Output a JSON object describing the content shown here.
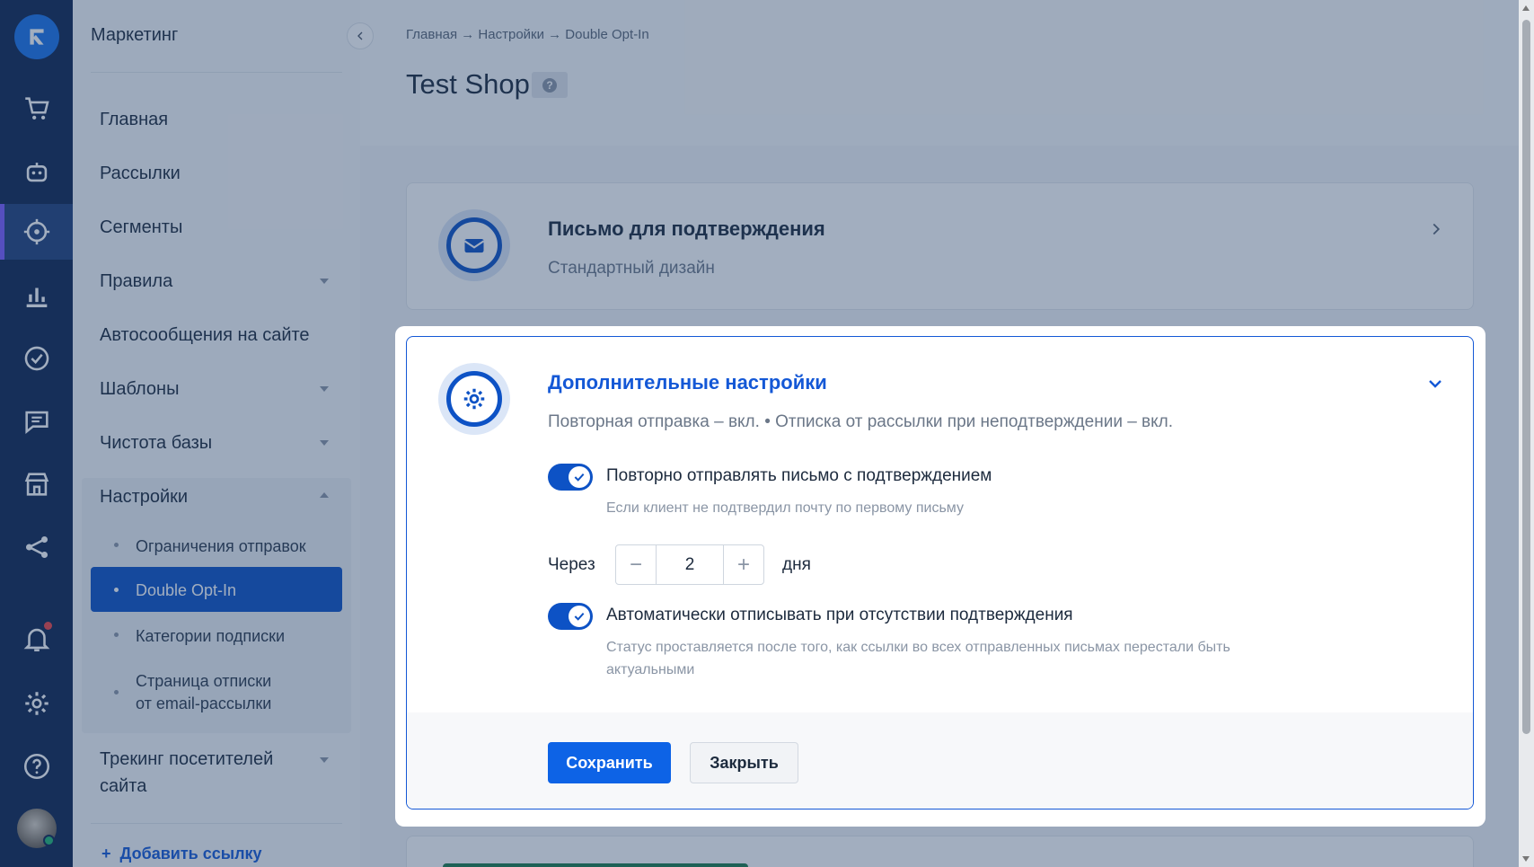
{
  "sidebar": {
    "title": "Маркетинг",
    "items": [
      {
        "label": "Главная"
      },
      {
        "label": "Рассылки"
      },
      {
        "label": "Сегменты"
      },
      {
        "label": "Правила"
      },
      {
        "label": "Автосообщения на сайте"
      },
      {
        "label": "Шаблоны"
      },
      {
        "label": "Чистота базы"
      },
      {
        "label": "Настройки"
      },
      {
        "label": "Трекинг посетителей сайта"
      }
    ],
    "sub_items": [
      {
        "label": "Ограничения отправок"
      },
      {
        "label": "Double Opt-In"
      },
      {
        "label": "Категории подписки"
      },
      {
        "label": "Страница отписки от email-рассылки"
      }
    ],
    "tracking_line1": "Трекинг посетителей",
    "tracking_line2": "сайта",
    "unsub_line1": "Страница отписки",
    "unsub_line2": "от email-рассылки",
    "add_link": "Добавить ссылку",
    "add_link_icon": "+"
  },
  "rail": {
    "icons": [
      "logo-icon",
      "cart-icon",
      "robot-icon",
      "target-icon",
      "chart-icon",
      "check-circle-icon",
      "chat-icon",
      "store-icon",
      "share-icon",
      "bell-icon",
      "gear-icon",
      "help-icon"
    ],
    "active": "target-icon"
  },
  "header": {
    "breadcrumb": "Главная → Настройки → Double Opt-In",
    "title": "Test Shop",
    "help_icon": "?"
  },
  "card_letter": {
    "title": "Письмо для подтверждения",
    "subtitle": "Стандартный дизайн"
  },
  "card_settings": {
    "title": "Дополнительные настройки",
    "summary": "Повторная отправка – вкл.  •  Отписка от рассылки при неподтверждении – вкл.",
    "resend_label": "Повторно отправлять письмо с подтверждением",
    "resend_hint": "Если клиент не подтвердил почту по первому письму",
    "resend_enabled": true,
    "delay_prefix": "Через",
    "delay_value": "2",
    "delay_suffix": "дня",
    "minus": "−",
    "plus": "+",
    "auto_label": "Автоматически отписывать при отсутствии подтверждения",
    "auto_hint": "Статус проставляется после того, как ссылки во всех отправленных письмах перестали быть актуальными",
    "auto_enabled": true,
    "save_label": "Сохранить",
    "close_label": "Закрыть"
  },
  "colors": {
    "accent": "#1458d6",
    "rail_bg": "#0f2550",
    "primary_button": "#0d63e6"
  }
}
